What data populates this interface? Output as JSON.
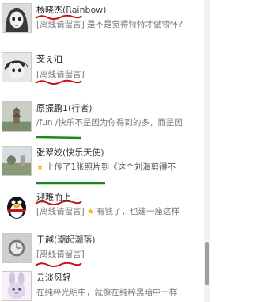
{
  "contacts": [
    {
      "name": "杨晓杰",
      "nick": "(Rainbow)",
      "status": "[离线请留言]  是不是觉得特特才傲物怀?",
      "avatar_icon": "manga-girl-avatar-icon",
      "underline_color": "#cc1111"
    },
    {
      "name": "芠ぇ泊",
      "nick": "",
      "status": "[离线请留言]",
      "avatar_icon": "manga-boy-avatar-icon",
      "underline_color": "#cc1111"
    },
    {
      "name": "原振鹏1",
      "nick": "(行者)",
      "status": "/fun /快乐不是因为你得到的多，而是因",
      "avatar_icon": "pagoda-photo-avatar-icon",
      "underline_color": "#1a8a1a"
    },
    {
      "name": "张翠姣",
      "nick": "(快乐天使)",
      "status": "上传了1张照片到《这个刘海剪得不",
      "avatar_icon": "outdoor-photo-avatar-icon",
      "underline_color": "#1a8a1a"
    },
    {
      "name": "迎难而上",
      "nick": "",
      "status_prefix": "[离线请留言]",
      "status": "有钱了，也建一座这样",
      "avatar_icon": "penguin-avatar-icon",
      "underline_color": "#cc1111"
    },
    {
      "name": "于越",
      "nick": "(潮起潮落)",
      "status": "[离线请留言]",
      "avatar_icon": "watch-photo-avatar-icon",
      "underline_color": "#cc1111"
    },
    {
      "name": "云淡风轻",
      "nick": "",
      "status": "在纯粹光明中，就像在纯粹黑暗中一样",
      "avatar_icon": "cartoon-rabbit-avatar-icon"
    }
  ]
}
